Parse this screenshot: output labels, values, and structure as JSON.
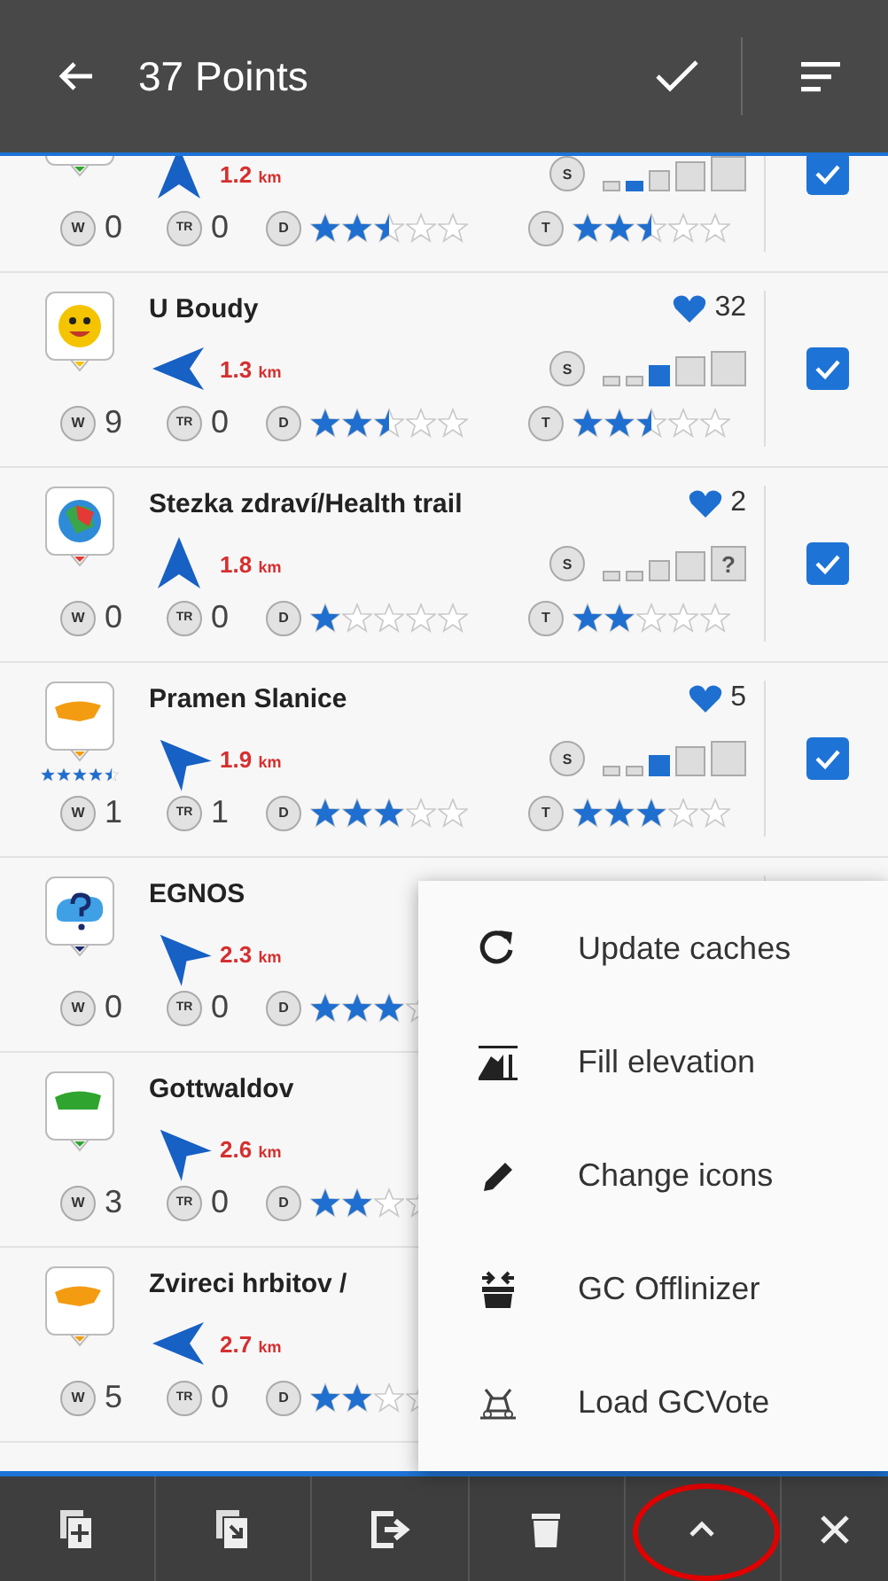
{
  "header": {
    "title": "37 Points"
  },
  "caches": [
    {
      "kind": "partial",
      "distance": "1.2",
      "unit": "km",
      "size": {
        "badge": "S",
        "kind": "micro"
      },
      "checked": true,
      "waypoints": {
        "badge": "W",
        "count": "0"
      },
      "trackables": {
        "badge": "TR",
        "count": "0"
      },
      "difficulty": {
        "badge": "D",
        "stars": 2.5
      },
      "terrain": {
        "badge": "T",
        "stars": 2.5
      }
    },
    {
      "kind": "full",
      "name": "U Boudy",
      "favorites": "32",
      "distance": "1.3",
      "unit": "km",
      "size": {
        "badge": "S",
        "kind": "small"
      },
      "checked": true,
      "waypoints": {
        "badge": "W",
        "count": "9"
      },
      "trackables": {
        "badge": "TR",
        "count": "0"
      },
      "difficulty": {
        "badge": "D",
        "stars": 2.5
      },
      "terrain": {
        "badge": "T",
        "stars": 2.5
      }
    },
    {
      "kind": "full",
      "name": "Stezka zdraví/Health trail",
      "favorites": "2",
      "distance": "1.8",
      "unit": "km",
      "size": {
        "badge": "S",
        "kind": "other",
        "mark": "?"
      },
      "checked": true,
      "waypoints": {
        "badge": "W",
        "count": "0"
      },
      "trackables": {
        "badge": "TR",
        "count": "0"
      },
      "difficulty": {
        "badge": "D",
        "stars": 1
      },
      "terrain": {
        "badge": "T",
        "stars": 2
      }
    },
    {
      "kind": "full",
      "name": "Pramen Slanice",
      "favorites": "5",
      "gcvote": {
        "stars": 4.5
      },
      "distance": "1.9",
      "unit": "km",
      "size": {
        "badge": "S",
        "kind": "small"
      },
      "checked": true,
      "waypoints": {
        "badge": "W",
        "count": "1"
      },
      "trackables": {
        "badge": "TR",
        "count": "1"
      },
      "difficulty": {
        "badge": "D",
        "stars": 3
      },
      "terrain": {
        "badge": "T",
        "stars": 3
      }
    },
    {
      "kind": "full",
      "name": "EGNOS",
      "distance": "2.3",
      "unit": "km",
      "waypoints": {
        "badge": "W",
        "count": "0"
      },
      "trackables": {
        "badge": "TR",
        "count": "0"
      },
      "difficulty": {
        "badge": "D",
        "stars": 3
      }
    },
    {
      "kind": "full",
      "name": "Gottwaldov",
      "distance": "2.6",
      "unit": "km",
      "waypoints": {
        "badge": "W",
        "count": "3"
      },
      "trackables": {
        "badge": "TR",
        "count": "0"
      },
      "difficulty": {
        "badge": "D",
        "stars": 2
      }
    },
    {
      "kind": "full",
      "name": "Zvireci hrbitov /",
      "distance": "2.7",
      "unit": "km",
      "waypoints": {
        "badge": "W",
        "count": "5"
      },
      "trackables": {
        "badge": "TR",
        "count": "0"
      },
      "difficulty": {
        "badge": "D",
        "stars": 2
      }
    }
  ],
  "menu": [
    {
      "label": "Update caches"
    },
    {
      "label": "Fill elevation"
    },
    {
      "label": "Change icons"
    },
    {
      "label": "GC Offlinizer"
    },
    {
      "label": "Load GCVote"
    }
  ],
  "toolbar": [
    {
      "highlighted": false
    },
    {
      "highlighted": false
    },
    {
      "highlighted": false
    },
    {
      "highlighted": false
    },
    {
      "highlighted": true
    },
    {
      "highlighted": false
    }
  ]
}
